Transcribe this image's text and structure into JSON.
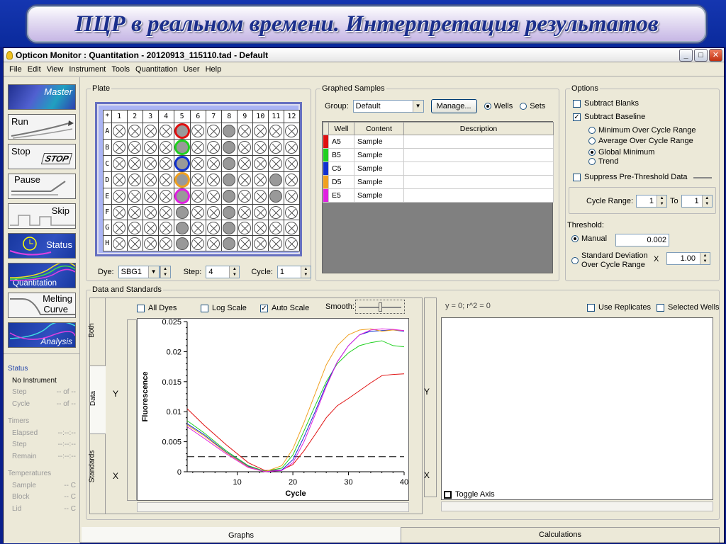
{
  "banner": {
    "title": "ПЦР в реальном времени. Интерпретация результатов"
  },
  "window": {
    "title": "Opticon Monitor : Quantitation - 20120913_115110.tad - Default"
  },
  "menu": [
    "File",
    "Edit",
    "View",
    "Instrument",
    "Tools",
    "Quantitation",
    "User",
    "Help"
  ],
  "left_nav": {
    "master": "Master",
    "run": "Run",
    "stop": "Stop",
    "stop_badge": "STOP",
    "pause": "Pause",
    "skip": "Skip",
    "status": "Status",
    "quantitation": "Quantitation",
    "melting": "Melting",
    "curve": "Curve",
    "analysis": "Analysis"
  },
  "status_panel": {
    "status_h": "Status",
    "instrument": "No Instrument",
    "step": "Step",
    "step_v": "-- of --",
    "cycle": "Cycle",
    "cycle_v": "-- of --",
    "timers_h": "Timers",
    "elapsed": "Elapsed",
    "elapsed_v": "--:--:--",
    "step2": "Step",
    "step2_v": "--:--:--",
    "remain": "Remain",
    "remain_v": "--:--:--",
    "temps_h": "Temperatures",
    "sample": "Sample",
    "sample_v": "-- C",
    "block": "Block",
    "block_v": "-- C",
    "lid": "Lid",
    "lid_v": "-- C"
  },
  "plate": {
    "legend": "Plate",
    "corner": "*",
    "cols": [
      "1",
      "2",
      "3",
      "4",
      "5",
      "6",
      "7",
      "8",
      "9",
      "10",
      "11",
      "12"
    ],
    "rows": [
      "A",
      "B",
      "C",
      "D",
      "E",
      "F",
      "G",
      "H"
    ],
    "dye_label": "Dye:",
    "dye_value": "SBG1",
    "step_label": "Step:",
    "step_value": "4",
    "cycle_label": "Cycle:",
    "cycle_value": "1"
  },
  "graphed": {
    "legend": "Graphed Samples",
    "group_label": "Group:",
    "group_value": "Default",
    "manage": "Manage...",
    "wells": "Wells",
    "sets": "Sets",
    "headers": [
      "Well",
      "Content",
      "Description"
    ],
    "rows": [
      {
        "well": "A5",
        "content": "Sample",
        "color": "#e01010"
      },
      {
        "well": "B5",
        "content": "Sample",
        "color": "#20d020"
      },
      {
        "well": "C5",
        "content": "Sample",
        "color": "#1030d0"
      },
      {
        "well": "D5",
        "content": "Sample",
        "color": "#f0a020"
      },
      {
        "well": "E5",
        "content": "Sample",
        "color": "#e020e0"
      }
    ]
  },
  "options": {
    "legend": "Options",
    "subtract_blanks": "Subtract Blanks",
    "subtract_baseline": "Subtract Baseline",
    "min_over": "Minimum Over Cycle Range",
    "avg_over": "Average Over Cycle Range",
    "global_min": "Global Minimum",
    "trend": "Trend",
    "suppress": "Suppress Pre-Threshold Data",
    "cycle_range": "Cycle Range:",
    "cycle_from": "1",
    "to": "To",
    "cycle_to": "1",
    "threshold": "Threshold:",
    "manual": "Manual",
    "manual_value": "0.002",
    "std_dev_1": "Standard Deviation",
    "std_dev_2": "Over Cycle Range",
    "times": "X",
    "std_value": "1.00"
  },
  "data_standards": {
    "legend": "Data and Standards",
    "all_dyes": "All Dyes",
    "log_scale": "Log Scale",
    "auto_scale": "Auto Scale",
    "smooth": "Smooth:",
    "eq": "y = 0;  r^2 = 0",
    "use_replicates": "Use Replicates",
    "selected_wells": "Selected Wells",
    "vtabs": [
      "Both",
      "Data",
      "Standards"
    ],
    "y": "Y",
    "x": "X",
    "toggle_axis": "Toggle Axis"
  },
  "bottom_tabs": [
    "Graphs",
    "Calculations"
  ],
  "chart_data": {
    "type": "line",
    "xlabel": "Cycle",
    "ylabel": "Fluorescence",
    "xlim": [
      1,
      40
    ],
    "ylim": [
      0,
      0.025
    ],
    "xticks": [
      "10",
      "20",
      "30",
      "40"
    ],
    "yticks": [
      "0",
      "0.005",
      "0.01",
      "0.015",
      "0.02",
      "0.025"
    ],
    "threshold": 0.0025,
    "series": [
      {
        "color": "#e01010",
        "x": [
          1,
          4,
          8,
          12,
          15,
          18,
          20,
          22,
          24,
          26,
          28,
          30,
          32,
          34,
          36,
          38,
          40
        ],
        "y": [
          0.0105,
          0.0078,
          0.0045,
          0.0015,
          0.0002,
          0.0003,
          0.0012,
          0.0035,
          0.0062,
          0.009,
          0.011,
          0.0122,
          0.0135,
          0.0148,
          0.016,
          0.0162,
          0.0163
        ]
      },
      {
        "color": "#20d020",
        "x": [
          1,
          4,
          8,
          12,
          15,
          18,
          20,
          22,
          24,
          26,
          28,
          30,
          32,
          34,
          36,
          38,
          40
        ],
        "y": [
          0.0085,
          0.0065,
          0.0035,
          0.001,
          0.0001,
          0.0006,
          0.0028,
          0.0068,
          0.011,
          0.015,
          0.018,
          0.0198,
          0.021,
          0.0215,
          0.0218,
          0.021,
          0.0208
        ]
      },
      {
        "color": "#1030d0",
        "x": [
          1,
          4,
          8,
          12,
          15,
          18,
          20,
          22,
          24,
          26,
          28,
          30,
          32,
          34,
          36,
          38,
          40
        ],
        "y": [
          0.008,
          0.0062,
          0.0033,
          0.0009,
          0.0,
          0.0003,
          0.002,
          0.0058,
          0.01,
          0.0145,
          0.0183,
          0.021,
          0.0228,
          0.0234,
          0.0235,
          0.0236,
          0.0234
        ]
      },
      {
        "color": "#f0a020",
        "x": [
          1,
          4,
          8,
          12,
          15,
          18,
          20,
          22,
          24,
          26,
          28,
          30,
          32,
          34,
          36,
          38,
          40
        ],
        "y": [
          0.0078,
          0.006,
          0.0032,
          0.0008,
          0.0,
          0.001,
          0.0038,
          0.0082,
          0.013,
          0.0178,
          0.021,
          0.0228,
          0.0236,
          0.0238,
          0.0234,
          0.0236,
          0.0235
        ]
      },
      {
        "color": "#e020e0",
        "x": [
          1,
          4,
          8,
          12,
          15,
          18,
          20,
          22,
          24,
          26,
          28,
          30,
          32,
          34,
          36,
          38,
          40
        ],
        "y": [
          0.0075,
          0.0056,
          0.003,
          0.0007,
          0.0,
          0.0002,
          0.0015,
          0.005,
          0.0095,
          0.0142,
          0.0183,
          0.021,
          0.0228,
          0.0236,
          0.0238,
          0.0237,
          0.0235
        ]
      }
    ]
  }
}
